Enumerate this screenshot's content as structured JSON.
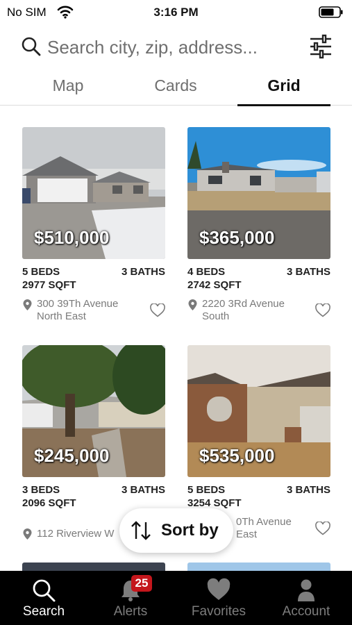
{
  "status_bar": {
    "carrier": "No SIM",
    "time": "3:16 PM",
    "wifi_icon": "wifi-icon",
    "battery_icon": "battery-icon"
  },
  "search": {
    "placeholder": "Search city, zip, address...",
    "icon": "search-icon",
    "filter_icon": "filter-sliders-icon"
  },
  "tabs": [
    {
      "label": "Map",
      "active": false
    },
    {
      "label": "Cards",
      "active": false
    },
    {
      "label": "Grid",
      "active": true
    }
  ],
  "listings": [
    {
      "price": "$510,000",
      "beds": "5 BEDS",
      "baths": "3 BATHS",
      "sqft": "2977 SQFT",
      "address_line1": "300 39Th Avenue",
      "address_line2": "North East"
    },
    {
      "price": "$365,000",
      "beds": "4 BEDS",
      "baths": "3 BATHS",
      "sqft": "2742 SQFT",
      "address_line1": "2220 3Rd Avenue",
      "address_line2": "South"
    },
    {
      "price": "$245,000",
      "beds": "3 BEDS",
      "baths": "3 BATHS",
      "sqft": "2096 SQFT",
      "address_line1": "112 Riverview W",
      "address_line2": ""
    },
    {
      "price": "$535,000",
      "beds": "5 BEDS",
      "baths": "3 BATHS",
      "sqft": "3254 SQFT",
      "address_line1": "0Th Avenue",
      "address_line2": "East"
    }
  ],
  "sort": {
    "label": "Sort by",
    "icon": "sort-arrows-icon"
  },
  "bottom_nav": [
    {
      "label": "Search",
      "icon": "search-icon",
      "active": true
    },
    {
      "label": "Alerts",
      "icon": "bell-icon",
      "badge": "25",
      "active": false
    },
    {
      "label": "Favorites",
      "icon": "heart-icon",
      "active": false
    },
    {
      "label": "Account",
      "icon": "person-icon",
      "active": false
    }
  ],
  "colors": {
    "accent": "#111111",
    "badge": "#c4161c",
    "nav_background": "#000000",
    "nav_inactive": "#7d7d7d"
  }
}
